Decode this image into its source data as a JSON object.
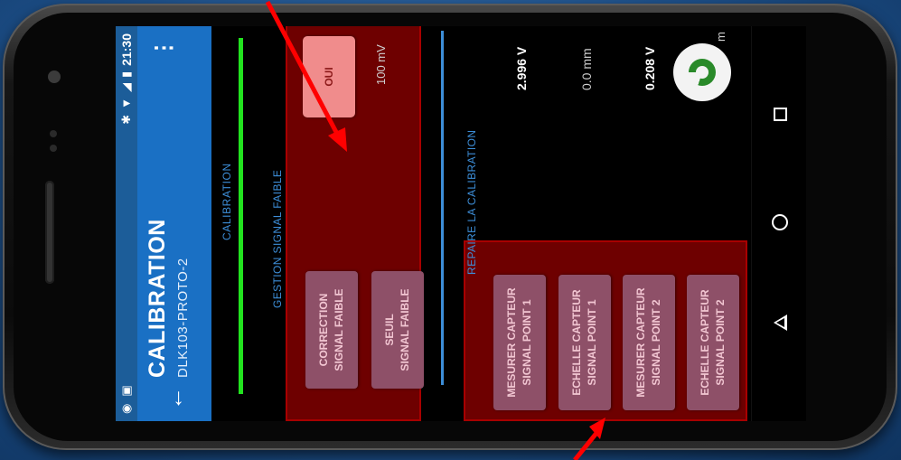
{
  "status_bar": {
    "time": "21:30",
    "left_icons": [
      "app-notification-icon",
      "app-notification-icon-2"
    ],
    "right_icons": [
      "bluetooth-icon",
      "wifi-icon",
      "signal-icon",
      "battery-icon"
    ]
  },
  "app_bar": {
    "title": "CALIBRATION",
    "subtitle": "DLK103-PROTO-2",
    "back_icon": "arrow-back-icon",
    "menu_icon": "more-vert-icon",
    "menu_glyph": "⋮"
  },
  "tab": {
    "label": "CALIBRATION"
  },
  "gestion": {
    "label": "GESTION SIGNAL FAIBLE",
    "buttons": [
      {
        "line1": "CORRECTION",
        "line2": "SIGNAL FAIBLE"
      },
      {
        "line1": "SEUIL",
        "line2": "SIGNAL FAIBLE"
      }
    ],
    "toggle_label": "OUI",
    "threshold_value": "100 mV"
  },
  "repaire": {
    "label": "REPAIRE LA CALIBRATION",
    "buttons": [
      {
        "line1": "MESURER CAPTEUR",
        "line2": "SIGNAL POINT 1"
      },
      {
        "line1": "ECHELLE CAPTEUR",
        "line2": "SIGNAL POINT 1"
      },
      {
        "line1": "MESURER CAPTEUR",
        "line2": "SIGNAL POINT 2"
      },
      {
        "line1": "ECHELLE CAPTEUR",
        "line2": "SIGNAL POINT 2"
      }
    ],
    "values": [
      "2.996 V",
      "0.0 mm",
      "0.208 V",
      "m"
    ]
  },
  "fab": {
    "icon": "refresh-icon"
  },
  "nav": {
    "icons": [
      "recent-apps-icon",
      "home-icon",
      "back-nav-icon"
    ]
  },
  "colors": {
    "status_bar": "#1c5d99",
    "app_bar": "#1a70c4",
    "tab_indicator": "#22e31f",
    "section_label": "#3d8ed8",
    "highlight_box": "#6e0000",
    "button": "#8e5068",
    "toggle_on": "#f08c8c",
    "annotation_arrow": "#ff0000"
  }
}
